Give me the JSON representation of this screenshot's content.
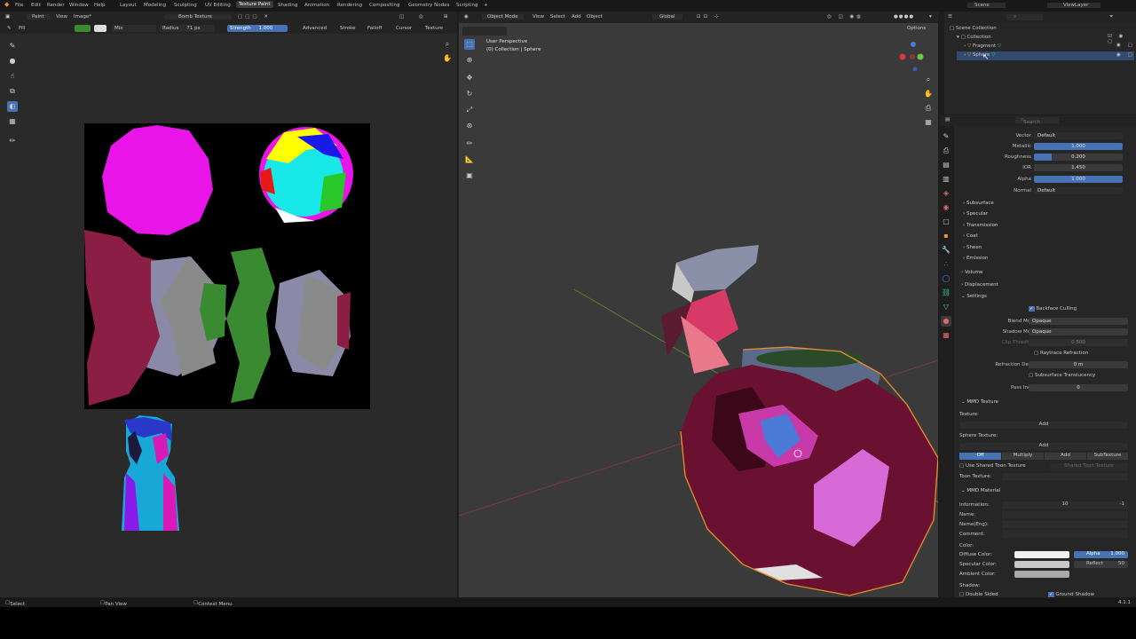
{
  "topbar": {
    "menus": [
      "File",
      "Edit",
      "Render",
      "Window",
      "Help"
    ],
    "workspaces": [
      "Layout",
      "Modeling",
      "Sculpting",
      "UV Editing",
      "Texture Paint",
      "Shading",
      "Animation",
      "Rendering",
      "Compositing",
      "Geometry Nodes",
      "Scripting"
    ],
    "active_workspace": "Texture Paint",
    "scene": "Scene",
    "view_layer": "ViewLayer"
  },
  "image_editor": {
    "mode": "Paint",
    "menus": [
      "View",
      "Image*"
    ],
    "image_name": "Bomb Texture",
    "fill_label": "Fill",
    "blend": "Mix",
    "radius_label": "Radius",
    "radius_value": "71 px",
    "strength_label": "Strength",
    "strength_value": "1.000",
    "dropdowns": [
      "Advanced",
      "Stroke",
      "Falloff",
      "Cursor",
      "Texture"
    ]
  },
  "viewport": {
    "mode": "Object Mode",
    "menus": [
      "View",
      "Select",
      "Add",
      "Object"
    ],
    "transform": "Global",
    "overlay_title": "User Perspective",
    "overlay_sub": "(0) Collection | Sphere",
    "options": "Options"
  },
  "outliner": {
    "items": [
      "Scene Collection",
      "Collection",
      "Fragment",
      "Sphere"
    ]
  },
  "properties": {
    "search_placeholder": "Search",
    "rows": [
      {
        "label": "Vector",
        "value": "Default",
        "type": "link"
      },
      {
        "label": "Metallic",
        "value": "1.000",
        "type": "slider",
        "fill": 1.0
      },
      {
        "label": "Roughness",
        "value": "0.200",
        "type": "slider",
        "fill": 0.2
      },
      {
        "label": "IOR",
        "value": "1.450",
        "type": "field"
      },
      {
        "label": "Alpha",
        "value": "1.000",
        "type": "slider",
        "fill": 1.0
      },
      {
        "label": "Normal",
        "value": "Default",
        "type": "link"
      }
    ],
    "subsections": [
      "Subsurface",
      "Specular",
      "Transmission",
      "Coat",
      "Sheen",
      "Emission"
    ],
    "sections": [
      "Volume",
      "Displacement",
      "Settings"
    ],
    "backface_culling": "Backface Culling",
    "blend_mode_label": "Blend Mode",
    "blend_mode": "Opaque",
    "shadow_mode_label": "Shadow Mode",
    "shadow_mode": "Opaque",
    "clip_threshold_label": "Clip Threshold",
    "clip_threshold": "0.500",
    "raytrace_refraction": "Raytrace Refraction",
    "refraction_depth_label": "Refraction Depth",
    "refraction_depth": "0 m",
    "subsurface_translucency": "Subsurface Translucency",
    "pass_index_label": "Pass Index",
    "pass_index": "0",
    "mmd_texture": "MMD Texture",
    "texture_label": "Texture:",
    "add_label": "Add",
    "sphere_texture_label": "Sphere Texture:",
    "sphere_modes": [
      "Off",
      "Multiply",
      "Add",
      "SubTexture"
    ],
    "use_shared_toon": "Use Shared Toon Texture",
    "shared_toon_texture": "Shared Toon Texture",
    "toon_texture_label": "Toon Texture:",
    "mmd_material": "MMD Material",
    "information_label": "Information:",
    "information_value": "10",
    "information_extra": "-1",
    "name_labels": [
      "Name:",
      "Name(Eng):",
      "Comment:"
    ],
    "color_label": "Color:",
    "diffuse_label": "Diffuse Color:",
    "alpha_label": "Alpha",
    "alpha_value": "1.000",
    "specular_label": "Specular Color:",
    "reflect_label": "Reflect",
    "reflect_value": "50",
    "ambient_label": "Ambient Color:",
    "shadow_label": "Shadow:",
    "double_sided": "Double Sided",
    "ground_shadow": "Ground Shadow"
  },
  "status": {
    "select": "Select",
    "pan": "Pan View",
    "context": "Context Menu",
    "version": "4.1.1"
  },
  "colors": {
    "accent": "#4772b3",
    "magenta": "#e814e8",
    "green": "#3a8a32",
    "maroon": "#8a1e44"
  }
}
